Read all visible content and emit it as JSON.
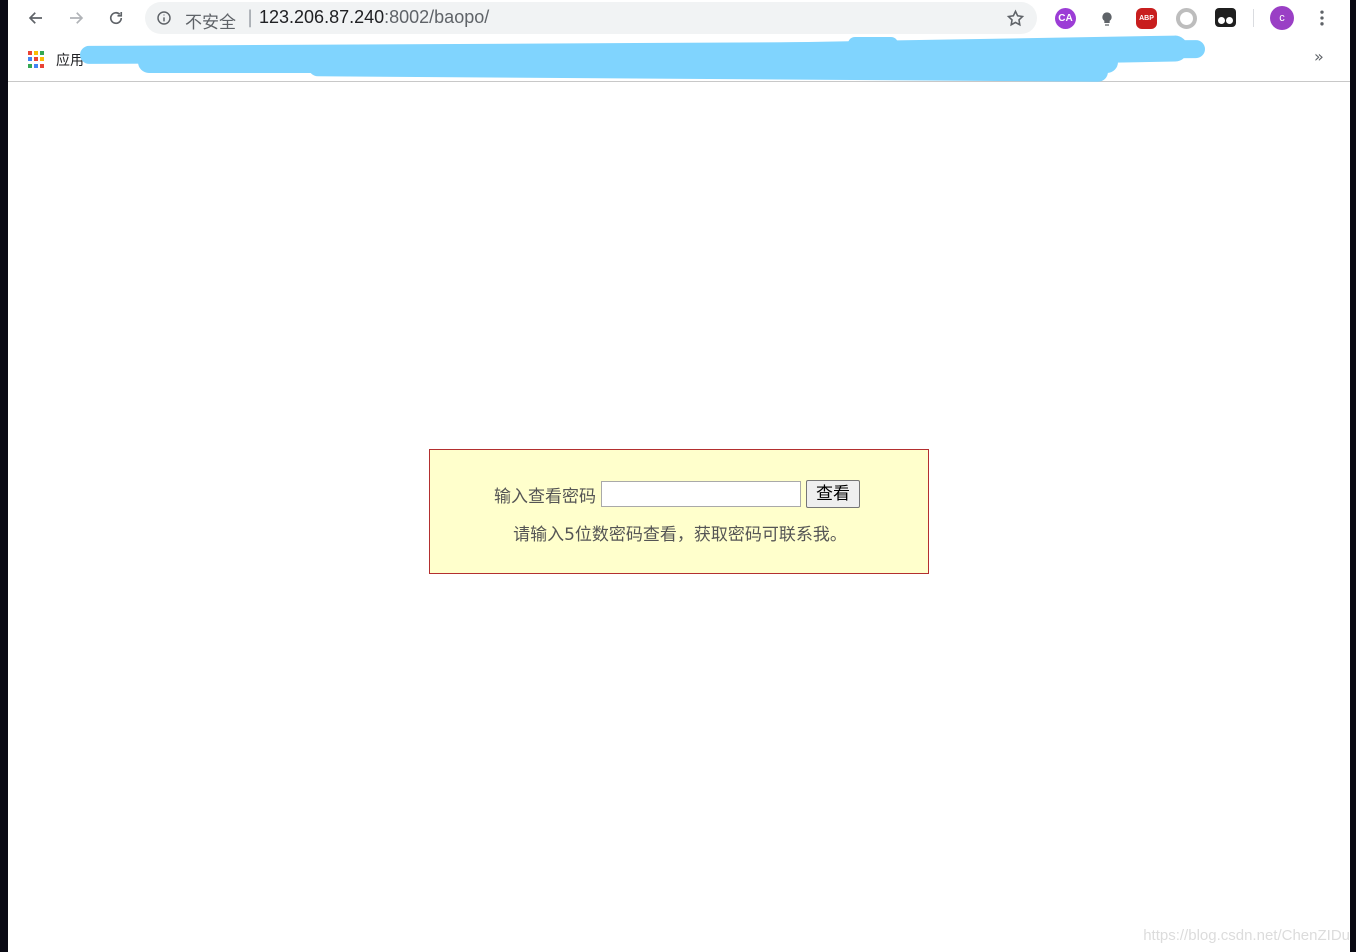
{
  "browser": {
    "security_label": "不安全",
    "url_separator": "|",
    "url_host": "123.206.87.240",
    "url_rest": ":8002/baopo/",
    "extensions": {
      "ca_label": "CA",
      "abp_label": "ABP"
    },
    "avatar_initial": "c",
    "more_bookmarks": "»"
  },
  "bookmarks": {
    "apps_label": "应用"
  },
  "page": {
    "prompt_label": "输入查看密码",
    "password_value": "",
    "view_button": "查看",
    "hint": "请输入5位数密码查看，获取密码可联系我。",
    "colors": {
      "box_background": "#ffffcc",
      "box_border": "#b32f2f",
      "redaction": "#80d4fe"
    }
  },
  "watermark": "https://blog.csdn.net/ChenZIDu"
}
